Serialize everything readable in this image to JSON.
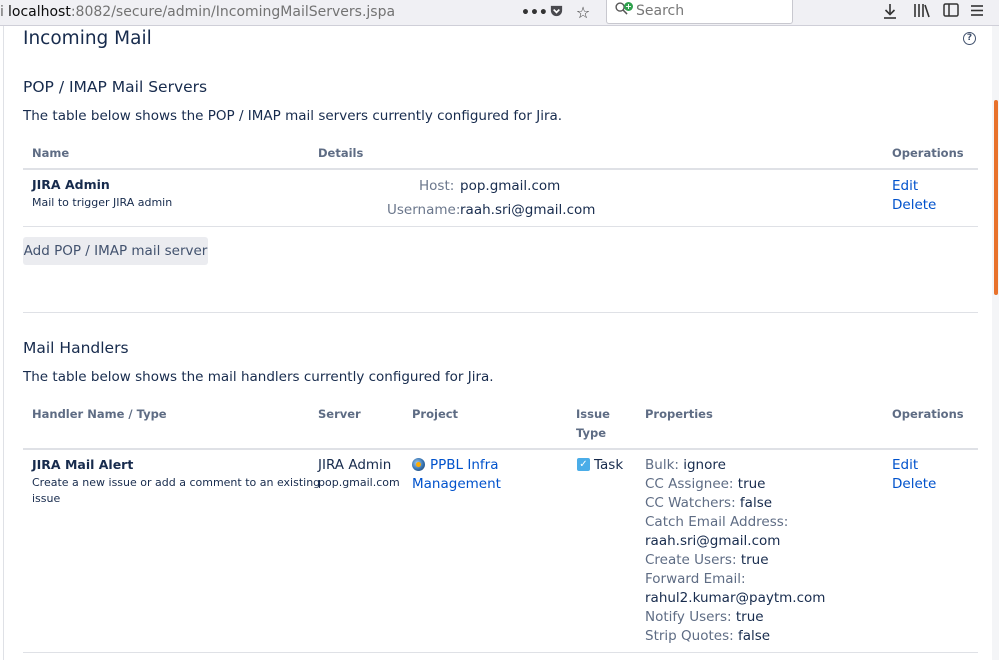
{
  "browser": {
    "url_host": "localhost",
    "url_path": ":8082/secure/admin/IncomingMailServers.jspa",
    "search_placeholder": "Search",
    "icons": [
      "info-icon",
      "more-icon",
      "pocket-icon",
      "bookmark-star-icon",
      "search-icon",
      "download-icon",
      "library-icon",
      "sidebar-icon",
      "menu-icon"
    ]
  },
  "page": {
    "title": "Incoming Mail",
    "help_icon_label": "?"
  },
  "pop": {
    "heading": "POP / IMAP Mail Servers",
    "description": "The table below shows the POP / IMAP mail servers currently configured for Jira.",
    "columns": {
      "name": "Name",
      "details": "Details",
      "operations": "Operations"
    },
    "rows": [
      {
        "name": "JIRA Admin",
        "description": "Mail to trigger JIRA admin",
        "host_label": "Host:",
        "host": "pop.gmail.com",
        "username_label": "Username:",
        "username": "raah.sri@gmail.com",
        "edit": "Edit",
        "delete": "Delete"
      }
    ],
    "add_button": "Add POP / IMAP mail server"
  },
  "handlers": {
    "heading": "Mail Handlers",
    "description": "The table below shows the mail handlers currently configured for Jira.",
    "columns": {
      "name": "Handler Name / Type",
      "server": "Server",
      "project": "Project",
      "issue_type_1": "Issue",
      "issue_type_2": "Type",
      "properties": "Properties",
      "operations": "Operations"
    },
    "rows": [
      {
        "name": "JIRA Mail Alert",
        "type_1": "Create a new issue or add a comment to an existing",
        "type_2": "issue",
        "server_name": "JIRA Admin",
        "server_host": "pop.gmail.com",
        "project_1": "PPBL Infra",
        "project_2": "Management",
        "issue_type": "Task",
        "properties": [
          {
            "key": "Bulk:",
            "value": "ignore"
          },
          {
            "key": "CC Assignee:",
            "value": "true"
          },
          {
            "key": "CC Watchers:",
            "value": "false"
          },
          {
            "key": "Catch Email Address:",
            "value": ""
          },
          {
            "key": "",
            "value": "raah.sri@gmail.com"
          },
          {
            "key": "Create Users:",
            "value": "true"
          },
          {
            "key": "Forward Email:",
            "value": ""
          },
          {
            "key": "",
            "value": "rahul2.kumar@paytm.com"
          },
          {
            "key": "Notify Users:",
            "value": "true"
          },
          {
            "key": "Strip Quotes:",
            "value": "false"
          }
        ],
        "edit": "Edit",
        "delete": "Delete"
      }
    ]
  }
}
